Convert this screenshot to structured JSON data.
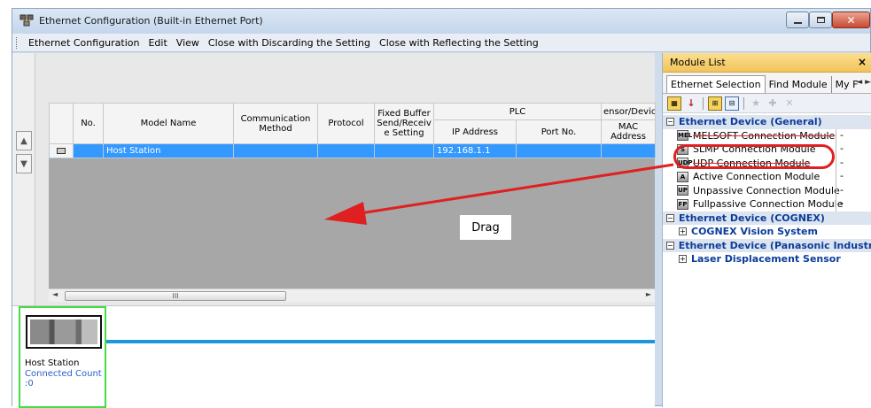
{
  "window": {
    "title": "Ethernet Configuration (Built-in Ethernet Port)",
    "menu": [
      "Ethernet Configuration",
      "Edit",
      "View",
      "Close with Discarding the Setting",
      "Close with Reflecting the Setting"
    ]
  },
  "table": {
    "headers": {
      "no": "No.",
      "model_name": "Model Name",
      "comm_method": "Communication Method",
      "protocol": "Protocol",
      "fixed_buffer": "Fixed Buffer Send/Receiv e Setting",
      "plc": "PLC",
      "ip_address": "IP Address",
      "port_no": "Port No.",
      "sensor_device": "ensor/Devic",
      "mac_address": "MAC Address"
    },
    "rows": [
      {
        "no": "",
        "model_name": "Host Station",
        "comm_method": "",
        "protocol": "",
        "fixed_buffer": "",
        "ip_address": "192.168.1.1",
        "port_no": "",
        "mac_address": ""
      }
    ],
    "scroll_thumb": "III"
  },
  "canvas": {
    "host_label": "Host Station",
    "connected_label": "Connected Count",
    "connected_value": ":0"
  },
  "module_list": {
    "title": "Module List",
    "close": "×",
    "tabs": [
      "Ethernet Selection",
      "Find Module",
      "My F"
    ],
    "tab_arrows": "◄ ►",
    "categories": [
      {
        "label": "Ethernet Device (General)",
        "items": [
          {
            "label": "MELSOFT Connection Module",
            "value": "-",
            "icon": "MEL"
          },
          {
            "label": "SLMP Connection Module",
            "value": "-",
            "icon": "S"
          },
          {
            "label": "UDP Connection Module",
            "value": "-",
            "icon": "UDP"
          },
          {
            "label": "Active Connection Module",
            "value": "-",
            "icon": "A"
          },
          {
            "label": "Unpassive Connection Module",
            "value": "-",
            "icon": "UP"
          },
          {
            "label": "Fullpassive Connection Module",
            "value": "-",
            "icon": "FP"
          }
        ]
      },
      {
        "label": "Ethernet Device (COGNEX)",
        "sub": "COGNEX Vision System"
      },
      {
        "label": "Ethernet Device (Panasonic Industria",
        "sub": "Laser Displacement Sensor"
      }
    ]
  },
  "annotation": {
    "drag_label": "Drag",
    "color": "#e02020"
  },
  "icons": {
    "expanded": "⊟",
    "collapsed": "⊞",
    "up": "▲",
    "down": "▼"
  }
}
